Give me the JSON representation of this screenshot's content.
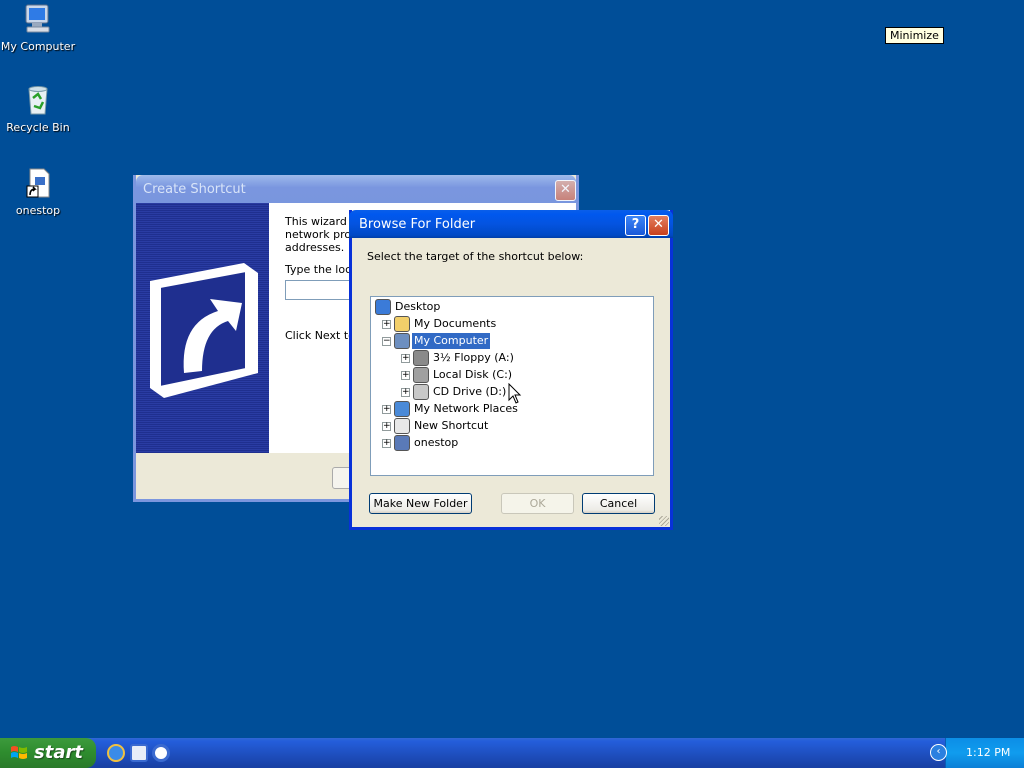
{
  "desktop": {
    "icons": [
      {
        "label": "My Computer",
        "icon": "my-computer-icon"
      },
      {
        "label": "Recycle Bin",
        "icon": "recycle-bin-icon"
      },
      {
        "label": "onestop",
        "icon": "shortcut-icon"
      }
    ]
  },
  "tooltip": {
    "text": "Minimize"
  },
  "wizard": {
    "title": "Create Shortcut",
    "intro_text": "This wizard he\nnetwork prog\naddresses.",
    "type_label": "Type the loca",
    "next_hint": "Click Next to c"
  },
  "browse": {
    "title": "Browse For Folder",
    "prompt": "Select the target of the shortcut below:",
    "tree": [
      {
        "label": "Desktop",
        "icon": "desktop-icon",
        "level": 0,
        "expander": null,
        "selected": false
      },
      {
        "label": "My Documents",
        "icon": "my-documents-icon",
        "level": 1,
        "expander": "+",
        "selected": false
      },
      {
        "label": "My Computer",
        "icon": "my-computer-icon",
        "level": 1,
        "expander": "−",
        "selected": true
      },
      {
        "label": "3½ Floppy (A:)",
        "icon": "floppy-drive-icon",
        "level": 2,
        "expander": "+",
        "selected": false
      },
      {
        "label": "Local Disk (C:)",
        "icon": "hard-disk-icon",
        "level": 2,
        "expander": "+",
        "selected": false
      },
      {
        "label": "CD Drive (D:)",
        "icon": "cd-drive-icon",
        "level": 2,
        "expander": "+",
        "selected": false
      },
      {
        "label": "My Network Places",
        "icon": "network-places-icon",
        "level": 1,
        "expander": "+",
        "selected": false
      },
      {
        "label": "New Shortcut",
        "icon": "shortcut-file-icon",
        "level": 1,
        "expander": "+",
        "selected": false
      },
      {
        "label": "onestop",
        "icon": "shortcut-icon",
        "level": 1,
        "expander": "+",
        "selected": false
      }
    ],
    "buttons": {
      "make_new_folder": "Make New Folder",
      "ok": "OK",
      "cancel": "Cancel"
    },
    "title_buttons": {
      "help": "?",
      "close": "✕"
    }
  },
  "taskbar": {
    "start_label": "start",
    "clock": "1:12 PM",
    "tray_chevron": "‹"
  },
  "colors": {
    "desktop": "#004e98",
    "selection": "#316ac5",
    "titlebar_active": "#0058ee"
  }
}
